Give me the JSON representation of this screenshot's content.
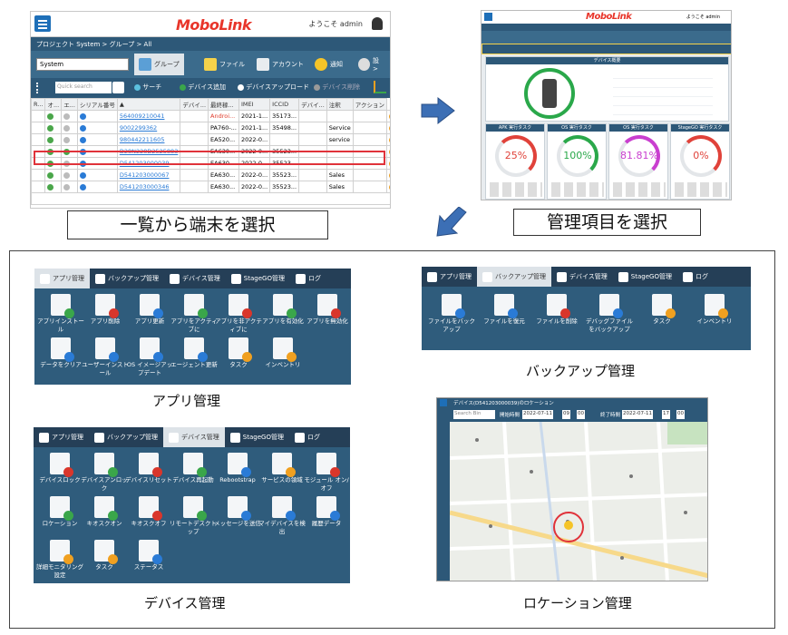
{
  "list_screen": {
    "logo": "MoboLink",
    "welcome": "ようこそ admin",
    "breadcrumb": "プロジェクト System  >  グループ  >  All",
    "group_select": "System",
    "tabs": [
      "グループ",
      "ファイル",
      "アカウント",
      "通知",
      "設 >"
    ],
    "search_placeholder": "Quick search",
    "search_button": "サーチ",
    "add_device": "デバイス追加",
    "upload_device": "デバイスアップロード",
    "delete_device": "デバイス削除",
    "columns": [
      "R...",
      "オ...",
      "エ...",
      "シリアル番号",
      "▲",
      "デバイ...",
      "最終稼...",
      "IMEI",
      "ICCID",
      "デバイ...",
      "注釈",
      "アクション"
    ],
    "rows": [
      {
        "serial": "564009210041",
        "model": "Androi...",
        "date": "2021-1...",
        "imei": "35173...",
        "note": ""
      },
      {
        "serial": "9002299362",
        "model": "PA760-...",
        "date": "2021-1...",
        "imei": "35498...",
        "note": "Service"
      },
      {
        "serial": "980442211605",
        "model": "EA520...",
        "date": "2022-0...",
        "imei": "",
        "note": "service"
      },
      {
        "serial": "D28N228D2525883",
        "model": "EA630...",
        "date": "2022-0...",
        "imei": "35523...",
        "note": ""
      },
      {
        "serial": "D541203000039",
        "model": "EA630...",
        "date": "2022-0...",
        "imei": "35523...",
        "note": ""
      },
      {
        "serial": "D541203000067",
        "model": "EA630...",
        "date": "2022-0...",
        "imei": "35523...",
        "note": "Sales"
      },
      {
        "serial": "D541203000346",
        "model": "EA630...",
        "date": "2022-0...",
        "imei": "35523...",
        "note": "Sales"
      }
    ]
  },
  "detail_screen": {
    "logo": "MoboLink",
    "welcome": "ようこそ admin",
    "header_bar": "デバイス概要",
    "gauges": [
      {
        "title": "APK 実行タスク",
        "value": "25%",
        "color": "#e0423a"
      },
      {
        "title": "OS 実行タスク",
        "value": "100%",
        "color": "#2aa84a"
      },
      {
        "title": "OS 実行タスク",
        "value": "81.81%",
        "color": "#c93fcf"
      },
      {
        "title": "StageGO 実行タスク",
        "value": "0%",
        "color": "#e0423a"
      }
    ]
  },
  "labels": {
    "select_device": "一覧から端末を選択",
    "select_item": "管理項目を選択"
  },
  "app_panel": {
    "tabs": [
      "アプリ管理",
      "バックアップ管理",
      "デバイス管理",
      "StageGO管理",
      "ログ"
    ],
    "items": [
      {
        "label": "アプリインストール",
        "badge": "#3aa64a"
      },
      {
        "label": "アプリ削除",
        "badge": "#d9362b"
      },
      {
        "label": "アプリ更新",
        "badge": "#2a7bd6"
      },
      {
        "label": "アプリをアクティブに",
        "badge": "#3aa64a"
      },
      {
        "label": "アプリを非アクティブに",
        "badge": "#d9362b"
      },
      {
        "label": "アプリを有効化",
        "badge": "#3aa64a"
      },
      {
        "label": "アプリを無効化",
        "badge": "#d9362b"
      },
      {
        "label": "データをクリア",
        "badge": "#2a7bd6"
      },
      {
        "label": "ユーザーインストール",
        "badge": "#2a7bd6"
      },
      {
        "label": "OS イメージアップデート",
        "badge": "#2a7bd6"
      },
      {
        "label": "エージェント更新",
        "badge": "#2a7bd6"
      },
      {
        "label": "タスク",
        "badge": "#f0a020"
      },
      {
        "label": "インベントリ",
        "badge": "#f0a020"
      }
    ],
    "caption": "アプリ管理"
  },
  "backup_panel": {
    "tabs": [
      "アプリ管理",
      "バックアップ管理",
      "デバイス管理",
      "StageGO管理",
      "ログ"
    ],
    "items": [
      {
        "label": "ファイルをバックアップ",
        "badge": "#2a7bd6"
      },
      {
        "label": "ファイルを復元",
        "badge": "#2a7bd6"
      },
      {
        "label": "ファイルを削除",
        "badge": "#d9362b"
      },
      {
        "label": "デバッグファイルをバックアップ",
        "badge": "#2a7bd6"
      },
      {
        "label": "タスク",
        "badge": "#f0a020"
      },
      {
        "label": "インベントリ",
        "badge": "#f0a020"
      }
    ],
    "caption": "バックアップ管理"
  },
  "device_panel": {
    "tabs": [
      "アプリ管理",
      "バックアップ管理",
      "デバイス管理",
      "StageGO管理",
      "ログ"
    ],
    "items": [
      {
        "label": "デバイスロック",
        "badge": "#d9362b"
      },
      {
        "label": "デバイスアンロック",
        "badge": "#3aa64a"
      },
      {
        "label": "デバイスリセット",
        "badge": "#d9362b"
      },
      {
        "label": "デバイス再起動",
        "badge": "#3aa64a"
      },
      {
        "label": "Rebootstrap",
        "badge": "#2a7bd6"
      },
      {
        "label": "サービスの領域",
        "badge": "#f0a020"
      },
      {
        "label": "モジュール オン/オフ",
        "badge": "#d9362b"
      },
      {
        "label": "ロケーション",
        "badge": "#3aa64a"
      },
      {
        "label": "キオスクオン",
        "badge": "#3aa64a"
      },
      {
        "label": "キオスクオフ",
        "badge": "#d9362b"
      },
      {
        "label": "リモートデスクトップ",
        "badge": "#3aa64a"
      },
      {
        "label": "メッセージを送信",
        "badge": "#2a7bd6"
      },
      {
        "label": "マイデバイスを検出",
        "badge": "#2a7bd6"
      },
      {
        "label": "履歴データ",
        "badge": "#2a7bd6"
      },
      {
        "label": "詳細モニタリング設定",
        "badge": "#f0a020"
      },
      {
        "label": "タスク",
        "badge": "#f0a020"
      },
      {
        "label": "ステータス",
        "badge": "#2a7bd6"
      }
    ],
    "caption": "デバイス管理"
  },
  "location_panel": {
    "title": "デバイス(D541203000039)のロケーション",
    "search_placeholder": "Search Bin",
    "start_label": "開始時間",
    "start_date": "2022-07-11",
    "start_h": "09",
    "start_m": "00",
    "end_label": "終了時間",
    "end_date": "2022-07-11",
    "end_h": "17",
    "end_m": "00",
    "caption": "ロケーション管理"
  }
}
